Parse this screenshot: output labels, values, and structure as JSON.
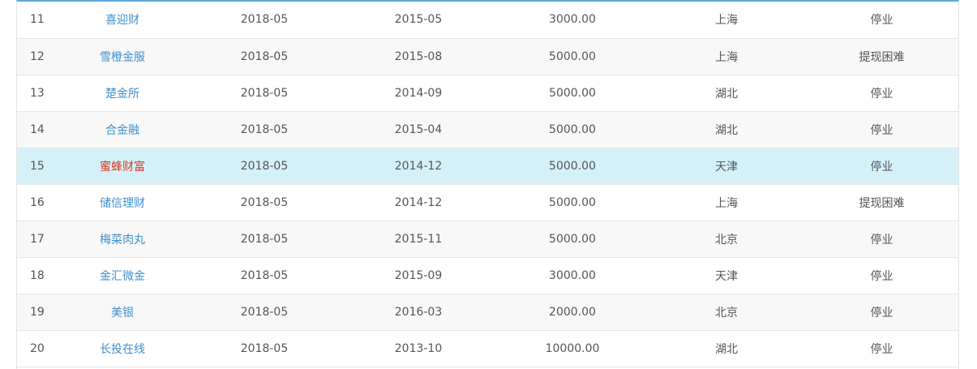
{
  "rows": [
    {
      "index": "11",
      "name": "喜迎财",
      "date1": "2018-05",
      "date2": "2015-05",
      "amount": "3000.00",
      "region": "上海",
      "status": "停业"
    },
    {
      "index": "12",
      "name": "雪橙金服",
      "date1": "2018-05",
      "date2": "2015-08",
      "amount": "5000.00",
      "region": "上海",
      "status": "提现困难"
    },
    {
      "index": "13",
      "name": "楚金所",
      "date1": "2018-05",
      "date2": "2014-09",
      "amount": "5000.00",
      "region": "湖北",
      "status": "停业"
    },
    {
      "index": "14",
      "name": "合金融",
      "date1": "2018-05",
      "date2": "2015-04",
      "amount": "5000.00",
      "region": "湖北",
      "status": "停业"
    },
    {
      "index": "15",
      "name": "蜜蜂财富",
      "date1": "2018-05",
      "date2": "2014-12",
      "amount": "5000.00",
      "region": "天津",
      "status": "停业"
    },
    {
      "index": "16",
      "name": "储信理财",
      "date1": "2018-05",
      "date2": "2014-12",
      "amount": "5000.00",
      "region": "上海",
      "status": "提现困难"
    },
    {
      "index": "17",
      "name": "梅菜肉丸",
      "date1": "2018-05",
      "date2": "2015-11",
      "amount": "5000.00",
      "region": "北京",
      "status": "停业"
    },
    {
      "index": "18",
      "name": "金汇微金",
      "date1": "2018-05",
      "date2": "2015-09",
      "amount": "3000.00",
      "region": "天津",
      "status": "停业"
    },
    {
      "index": "19",
      "name": "美银",
      "date1": "2018-05",
      "date2": "2016-03",
      "amount": "2000.00",
      "region": "北京",
      "status": "停业"
    },
    {
      "index": "20",
      "name": "长投在线",
      "date1": "2018-05",
      "date2": "2013-10",
      "amount": "10000.00",
      "region": "湖北",
      "status": "停业"
    }
  ],
  "colors": {
    "link": "#3f8fcd",
    "link_hover": "#d9381e",
    "row_highlight": "#d4f1fa",
    "row_alt": "#f8f8f8",
    "top_border": "#5fa8dc"
  }
}
